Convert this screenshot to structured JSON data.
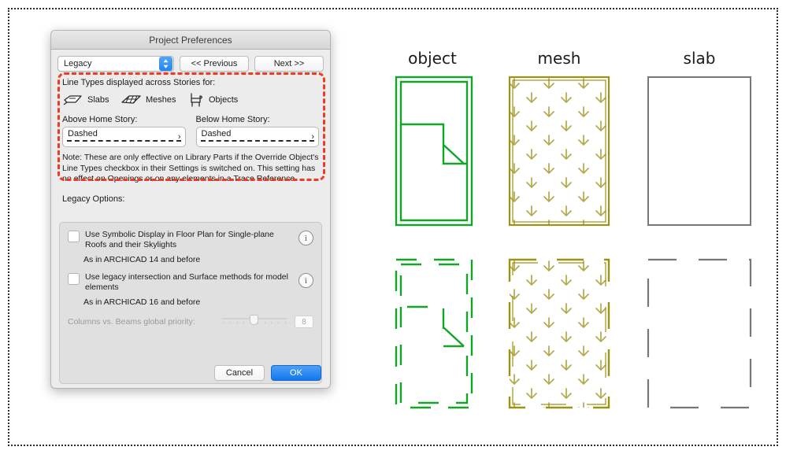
{
  "dialog": {
    "title": "Project Preferences",
    "toolbar": {
      "popup_value": "Legacy",
      "previous_label": "<< Previous",
      "next_label": "Next >>"
    },
    "line_types_section": {
      "heading": "Line Types displayed across Stories for:",
      "types": [
        {
          "label": "Slabs",
          "icon": "slab-icon"
        },
        {
          "label": "Meshes",
          "icon": "mesh-icon"
        },
        {
          "label": "Objects",
          "icon": "chair-icon"
        }
      ],
      "above_home_story": {
        "label": "Above Home Story:",
        "value": "Dashed"
      },
      "below_home_story": {
        "label": "Below Home Story:",
        "value": "Dashed"
      },
      "note": "Note: These are only effective on Library Parts if the Override Object's Line Types checkbox in their Settings is switched on. This setting has no effect on Openings or on any elements in a Trace Reference."
    },
    "legacy_options": {
      "heading": "Legacy Options:",
      "option1": {
        "label": "Use Symbolic Display in Floor Plan for Single-plane Roofs and their Skylights",
        "sublabel": "As in ARCHICAD 14 and before",
        "checked": false,
        "info_glyph": "i"
      },
      "option2": {
        "label": "Use legacy intersection and Surface methods for model elements",
        "sublabel": "As in ARCHICAD 16 and before",
        "checked": false,
        "info_glyph": "i"
      },
      "slider": {
        "label": "Columns vs. Beams global priority:",
        "value": "8",
        "min": 1,
        "max": 16,
        "disabled": true
      }
    },
    "footer": {
      "cancel_label": "Cancel",
      "ok_label": "OK"
    }
  },
  "drawings": {
    "columns": [
      {
        "title": "object",
        "color": "#11a627",
        "kind": "bed"
      },
      {
        "title": "mesh",
        "color": "#9b9316",
        "kind": "mesh"
      },
      {
        "title": "slab",
        "color": "#777777",
        "kind": "rect"
      }
    ],
    "rows": [
      {
        "style": "solid"
      },
      {
        "style": "dashed"
      }
    ]
  },
  "colors": {
    "highlight": "#ef3b24",
    "accent": "#1278ee",
    "object": "#11a627",
    "mesh": "#9b9316",
    "slab": "#777777"
  }
}
